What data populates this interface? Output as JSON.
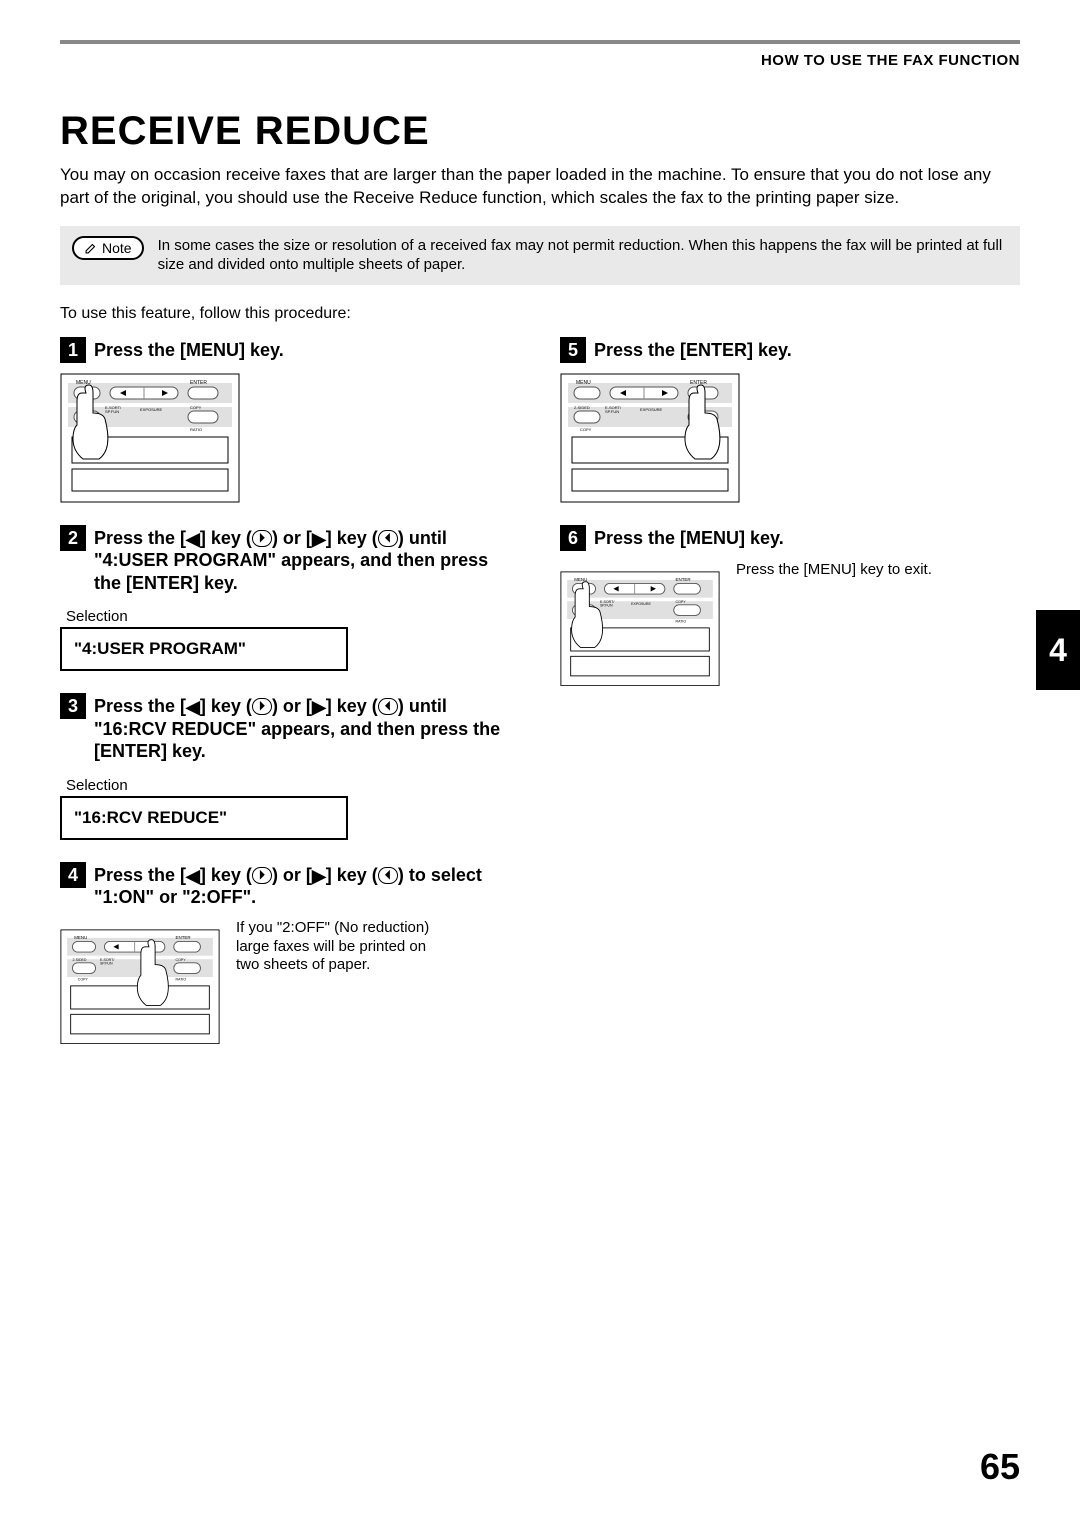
{
  "header": {
    "breadcrumb": "HOW TO USE THE FAX FUNCTION"
  },
  "title": "RECEIVE REDUCE",
  "intro": "You may on occasion receive faxes that are larger than the paper loaded in the machine. To ensure that you do not lose any part of the original, you should use the Receive Reduce function, which scales the fax to the printing paper size.",
  "note": {
    "label": "Note",
    "text": "In some cases the size or resolution of a received fax may not permit reduction. When this happens the fax will be printed at full size and divided onto multiple sheets of paper."
  },
  "lead": "To use this feature, follow this procedure:",
  "panel_labels": {
    "menu": "MENU",
    "enter": "ENTER",
    "twosided": "2-SIDED",
    "copy": "COPY",
    "esort": "E-SORT/",
    "spfun": "SP.FUN",
    "exposure": "EXPOSURE",
    "ratio": "RATIO"
  },
  "steps": {
    "s1": {
      "num": "1",
      "title": "Press the [MENU] key."
    },
    "s2": {
      "num": "2",
      "title_before": "Press the [",
      "title_mid": "] key (",
      "title_or": ") or [",
      "title_after": "] key (",
      "title_close": ")",
      "title_line2": "until \"4:USER PROGRAM\" appears, and then press the [ENTER] key.",
      "selection_label": "Selection",
      "lcd": "\"4:USER PROGRAM\""
    },
    "s3": {
      "num": "3",
      "title_line2": "until \"16:RCV REDUCE\" appears, and then press the [ENTER] key.",
      "selection_label": "Selection",
      "lcd": "\"16:RCV REDUCE\""
    },
    "s4": {
      "num": "4",
      "title_line2": "to select \"1:ON\" or \"2:OFF\".",
      "side": "If you \"2:OFF\"  (No reduction) large faxes will be printed on two sheets of paper."
    },
    "s5": {
      "num": "5",
      "title": "Press the [ENTER] key."
    },
    "s6": {
      "num": "6",
      "title": "Press the [MENU] key.",
      "side": "Press the [MENU] key to exit."
    }
  },
  "tab": "4",
  "pagenum": "65"
}
